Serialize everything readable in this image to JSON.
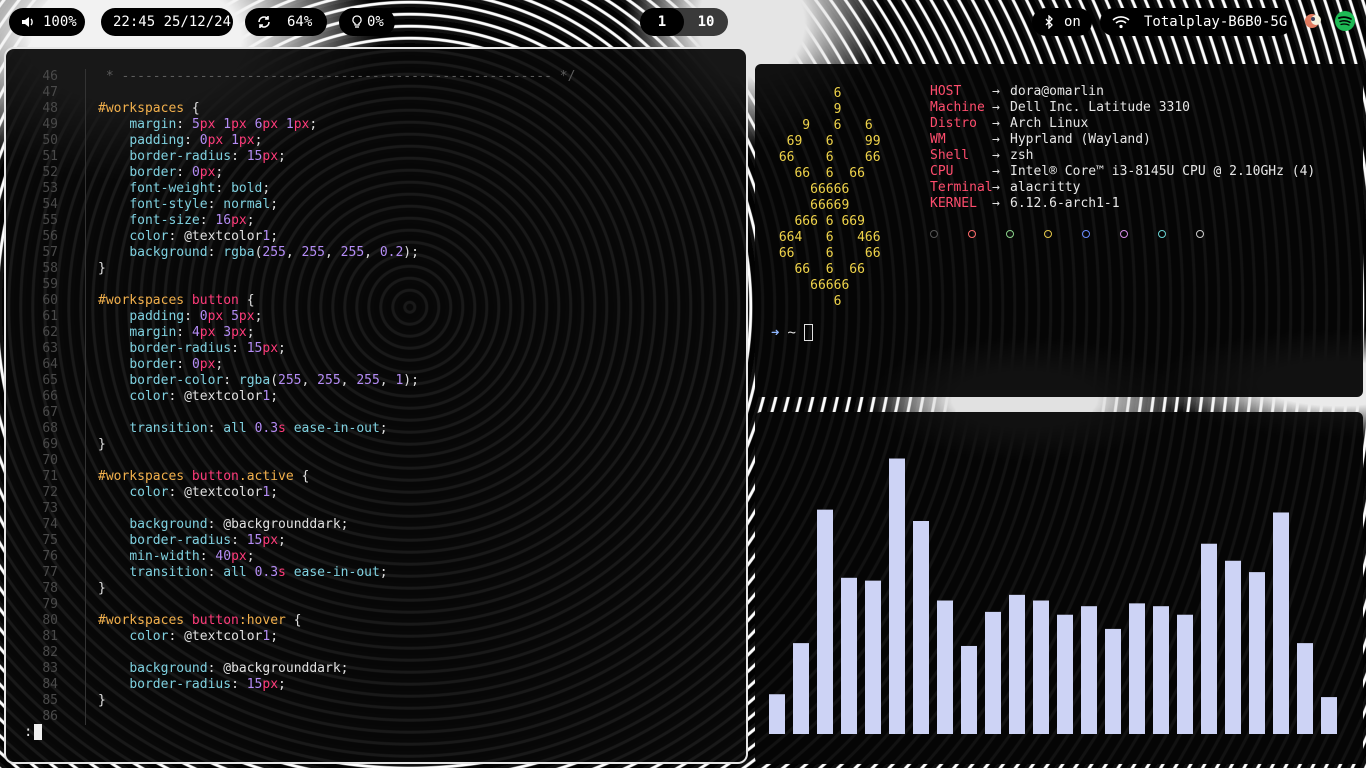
{
  "topbar": {
    "volume": {
      "icon": "speaker-icon",
      "value": "100%"
    },
    "clock": {
      "value": "22:45 25/12/24"
    },
    "sync": {
      "icon": "sync-icon",
      "value": "64%"
    },
    "brightness": {
      "icon": "lightbulb-icon",
      "value": "0%"
    },
    "workspaces": [
      {
        "label": "1",
        "active": true
      },
      {
        "label": "10",
        "active": false
      }
    ],
    "bluetooth": {
      "icon": "bluetooth-icon",
      "value": "on"
    },
    "wifi": {
      "icon": "wifi-icon",
      "value": "Totalplay-B6B0-5G"
    },
    "tray": [
      "app-tray-icon",
      "spotify-icon"
    ]
  },
  "editor": {
    "cmdline": ":",
    "lines": [
      {
        "n": "46",
        "t": [
          [
            "com",
            " * ------------------------------------------------------- */"
          ]
        ]
      },
      {
        "n": "47",
        "t": []
      },
      {
        "n": "48",
        "t": [
          [
            "sel",
            "#workspaces"
          ],
          [
            "punc",
            " {"
          ]
        ]
      },
      {
        "n": "49",
        "t": [
          [
            "ind",
            "    "
          ],
          [
            "prop",
            "margin"
          ],
          [
            "punc",
            ": "
          ],
          [
            "num",
            "5"
          ],
          [
            "unit",
            "px"
          ],
          [
            "punc",
            " "
          ],
          [
            "num",
            "1"
          ],
          [
            "unit",
            "px"
          ],
          [
            "punc",
            " "
          ],
          [
            "num",
            "6"
          ],
          [
            "unit",
            "px"
          ],
          [
            "punc",
            " "
          ],
          [
            "num",
            "1"
          ],
          [
            "unit",
            "px"
          ],
          [
            "punc",
            ";"
          ]
        ]
      },
      {
        "n": "50",
        "t": [
          [
            "ind",
            "    "
          ],
          [
            "prop",
            "padding"
          ],
          [
            "punc",
            ": "
          ],
          [
            "num",
            "0"
          ],
          [
            "unit",
            "px"
          ],
          [
            "punc",
            " "
          ],
          [
            "num",
            "1"
          ],
          [
            "unit",
            "px"
          ],
          [
            "punc",
            ";"
          ]
        ]
      },
      {
        "n": "51",
        "t": [
          [
            "ind",
            "    "
          ],
          [
            "prop",
            "border-radius"
          ],
          [
            "punc",
            ": "
          ],
          [
            "num",
            "15"
          ],
          [
            "unit",
            "px"
          ],
          [
            "punc",
            ";"
          ]
        ]
      },
      {
        "n": "52",
        "t": [
          [
            "ind",
            "    "
          ],
          [
            "prop",
            "border"
          ],
          [
            "punc",
            ": "
          ],
          [
            "num",
            "0"
          ],
          [
            "unit",
            "px"
          ],
          [
            "punc",
            ";"
          ]
        ]
      },
      {
        "n": "53",
        "t": [
          [
            "ind",
            "    "
          ],
          [
            "prop",
            "font-weight"
          ],
          [
            "punc",
            ": "
          ],
          [
            "val",
            "bold"
          ],
          [
            "punc",
            ";"
          ]
        ]
      },
      {
        "n": "54",
        "t": [
          [
            "ind",
            "    "
          ],
          [
            "prop",
            "font-style"
          ],
          [
            "punc",
            ": "
          ],
          [
            "val",
            "normal"
          ],
          [
            "punc",
            ";"
          ]
        ]
      },
      {
        "n": "55",
        "t": [
          [
            "ind",
            "    "
          ],
          [
            "prop",
            "font-size"
          ],
          [
            "punc",
            ": "
          ],
          [
            "num",
            "16"
          ],
          [
            "unit",
            "px"
          ],
          [
            "punc",
            ";"
          ]
        ]
      },
      {
        "n": "56",
        "t": [
          [
            "ind",
            "    "
          ],
          [
            "prop",
            "color"
          ],
          [
            "punc",
            ": "
          ],
          [
            "var",
            "@textcolor"
          ],
          [
            "num",
            "1"
          ],
          [
            "punc",
            ";"
          ]
        ]
      },
      {
        "n": "57",
        "t": [
          [
            "ind",
            "    "
          ],
          [
            "prop",
            "background"
          ],
          [
            "punc",
            ": "
          ],
          [
            "val",
            "rgba"
          ],
          [
            "punc",
            "("
          ],
          [
            "num",
            "255"
          ],
          [
            "punc",
            ", "
          ],
          [
            "num",
            "255"
          ],
          [
            "punc",
            ", "
          ],
          [
            "num",
            "255"
          ],
          [
            "punc",
            ", "
          ],
          [
            "num",
            "0.2"
          ],
          [
            "punc",
            ");"
          ]
        ]
      },
      {
        "n": "58",
        "t": [
          [
            "punc",
            "}"
          ]
        ]
      },
      {
        "n": "59",
        "t": []
      },
      {
        "n": "60",
        "t": [
          [
            "sel",
            "#workspaces "
          ],
          [
            "unit",
            "button"
          ],
          [
            "punc",
            " {"
          ]
        ]
      },
      {
        "n": "61",
        "t": [
          [
            "ind",
            "    "
          ],
          [
            "prop",
            "padding"
          ],
          [
            "punc",
            ": "
          ],
          [
            "num",
            "0"
          ],
          [
            "unit",
            "px"
          ],
          [
            "punc",
            " "
          ],
          [
            "num",
            "5"
          ],
          [
            "unit",
            "px"
          ],
          [
            "punc",
            ";"
          ]
        ]
      },
      {
        "n": "62",
        "t": [
          [
            "ind",
            "    "
          ],
          [
            "prop",
            "margin"
          ],
          [
            "punc",
            ": "
          ],
          [
            "num",
            "4"
          ],
          [
            "unit",
            "px"
          ],
          [
            "punc",
            " "
          ],
          [
            "num",
            "3"
          ],
          [
            "unit",
            "px"
          ],
          [
            "punc",
            ";"
          ]
        ]
      },
      {
        "n": "63",
        "t": [
          [
            "ind",
            "    "
          ],
          [
            "prop",
            "border-radius"
          ],
          [
            "punc",
            ": "
          ],
          [
            "num",
            "15"
          ],
          [
            "unit",
            "px"
          ],
          [
            "punc",
            ";"
          ]
        ]
      },
      {
        "n": "64",
        "t": [
          [
            "ind",
            "    "
          ],
          [
            "prop",
            "border"
          ],
          [
            "punc",
            ": "
          ],
          [
            "num",
            "0"
          ],
          [
            "unit",
            "px"
          ],
          [
            "punc",
            ";"
          ]
        ]
      },
      {
        "n": "65",
        "t": [
          [
            "ind",
            "    "
          ],
          [
            "prop",
            "border-color"
          ],
          [
            "punc",
            ": "
          ],
          [
            "val",
            "rgba"
          ],
          [
            "punc",
            "("
          ],
          [
            "num",
            "255"
          ],
          [
            "punc",
            ", "
          ],
          [
            "num",
            "255"
          ],
          [
            "punc",
            ", "
          ],
          [
            "num",
            "255"
          ],
          [
            "punc",
            ", "
          ],
          [
            "num",
            "1"
          ],
          [
            "punc",
            ");"
          ]
        ]
      },
      {
        "n": "66",
        "t": [
          [
            "ind",
            "    "
          ],
          [
            "prop",
            "color"
          ],
          [
            "punc",
            ": "
          ],
          [
            "var",
            "@textcolor"
          ],
          [
            "num",
            "1"
          ],
          [
            "punc",
            ";"
          ]
        ]
      },
      {
        "n": "67",
        "t": []
      },
      {
        "n": "68",
        "t": [
          [
            "ind",
            "    "
          ],
          [
            "prop",
            "transition"
          ],
          [
            "punc",
            ": "
          ],
          [
            "val",
            "all "
          ],
          [
            "num",
            "0.3"
          ],
          [
            "unit",
            "s"
          ],
          [
            "punc",
            " "
          ],
          [
            "val",
            "ease-in-out"
          ],
          [
            "punc",
            ";"
          ]
        ]
      },
      {
        "n": "69",
        "t": [
          [
            "punc",
            "}"
          ]
        ]
      },
      {
        "n": "70",
        "t": []
      },
      {
        "n": "71",
        "t": [
          [
            "sel",
            "#workspaces "
          ],
          [
            "unit",
            "button"
          ],
          [
            "sel",
            ".active"
          ],
          [
            "punc",
            " {"
          ]
        ]
      },
      {
        "n": "72",
        "t": [
          [
            "ind",
            "    "
          ],
          [
            "prop",
            "color"
          ],
          [
            "punc",
            ": "
          ],
          [
            "var",
            "@textcolor"
          ],
          [
            "num",
            "1"
          ],
          [
            "punc",
            ";"
          ]
        ]
      },
      {
        "n": "73",
        "t": []
      },
      {
        "n": "74",
        "t": [
          [
            "ind",
            "    "
          ],
          [
            "prop",
            "background"
          ],
          [
            "punc",
            ": "
          ],
          [
            "var",
            "@backgrounddark"
          ],
          [
            "punc",
            ";"
          ]
        ]
      },
      {
        "n": "75",
        "t": [
          [
            "ind",
            "    "
          ],
          [
            "prop",
            "border-radius"
          ],
          [
            "punc",
            ": "
          ],
          [
            "num",
            "15"
          ],
          [
            "unit",
            "px"
          ],
          [
            "punc",
            ";"
          ]
        ]
      },
      {
        "n": "76",
        "t": [
          [
            "ind",
            "    "
          ],
          [
            "prop",
            "min-width"
          ],
          [
            "punc",
            ": "
          ],
          [
            "num",
            "40"
          ],
          [
            "unit",
            "px"
          ],
          [
            "punc",
            ";"
          ]
        ]
      },
      {
        "n": "77",
        "t": [
          [
            "ind",
            "    "
          ],
          [
            "prop",
            "transition"
          ],
          [
            "punc",
            ": "
          ],
          [
            "val",
            "all "
          ],
          [
            "num",
            "0.3"
          ],
          [
            "unit",
            "s"
          ],
          [
            "punc",
            " "
          ],
          [
            "val",
            "ease-in-out"
          ],
          [
            "punc",
            ";"
          ]
        ]
      },
      {
        "n": "78",
        "t": [
          [
            "punc",
            "}"
          ]
        ]
      },
      {
        "n": "79",
        "t": []
      },
      {
        "n": "80",
        "t": [
          [
            "sel",
            "#workspaces "
          ],
          [
            "unit",
            "button"
          ],
          [
            "sel",
            ":hover"
          ],
          [
            "punc",
            " {"
          ]
        ]
      },
      {
        "n": "81",
        "t": [
          [
            "ind",
            "    "
          ],
          [
            "prop",
            "color"
          ],
          [
            "punc",
            ": "
          ],
          [
            "var",
            "@textcolor"
          ],
          [
            "num",
            "1"
          ],
          [
            "punc",
            ";"
          ]
        ]
      },
      {
        "n": "82",
        "t": []
      },
      {
        "n": "83",
        "t": [
          [
            "ind",
            "    "
          ],
          [
            "prop",
            "background"
          ],
          [
            "punc",
            ": "
          ],
          [
            "var",
            "@backgrounddark"
          ],
          [
            "punc",
            ";"
          ]
        ]
      },
      {
        "n": "84",
        "t": [
          [
            "ind",
            "    "
          ],
          [
            "prop",
            "border-radius"
          ],
          [
            "punc",
            ": "
          ],
          [
            "num",
            "15"
          ],
          [
            "unit",
            "px"
          ],
          [
            "punc",
            ";"
          ]
        ]
      },
      {
        "n": "85",
        "t": [
          [
            "punc",
            "}"
          ]
        ]
      },
      {
        "n": "86",
        "t": []
      }
    ]
  },
  "neofetch": {
    "ascii": [
      "        6",
      "        9",
      "    9   6   6",
      "  69   6    99",
      " 66    6    66",
      "   66  6  66",
      "     66666",
      "     66669",
      "   666 6 669",
      " 664   6   466",
      " 66    6    66",
      "   66  6  66",
      "     66666",
      "        6"
    ],
    "info": [
      {
        "key": "HOST",
        "value": "dora@omarlin"
      },
      {
        "key": "Machine",
        "value": "Dell Inc. Latitude 3310"
      },
      {
        "key": "Distro",
        "value": "Arch Linux"
      },
      {
        "key": "WM",
        "value": "Hyprland (Wayland)"
      },
      {
        "key": "Shell",
        "value": "zsh"
      },
      {
        "key": "CPU",
        "value": "Intel® Core™ i3-8145U CPU @ 2.10GHz (4)"
      },
      {
        "key": "Terminal",
        "value": "alacritty"
      },
      {
        "key": "KERNEL",
        "value": "6.12.6-arch1-1"
      }
    ],
    "arrow": "→",
    "palette": [
      "#555555",
      "#ff6b6b",
      "#8bd48b",
      "#e6c84a",
      "#6b8cff",
      "#d58be6",
      "#6bd4d4",
      "#cccccc"
    ],
    "prompt": {
      "arrow": "➜",
      "dir": "~"
    }
  },
  "visualizer": {
    "bar_color": "#cdd3f5",
    "levels": [
      0.14,
      0.32,
      0.79,
      0.55,
      0.54,
      0.97,
      0.75,
      0.47,
      0.31,
      0.43,
      0.49,
      0.47,
      0.42,
      0.45,
      0.37,
      0.46,
      0.45,
      0.42,
      0.67,
      0.61,
      0.57,
      0.78,
      0.32,
      0.13
    ]
  }
}
